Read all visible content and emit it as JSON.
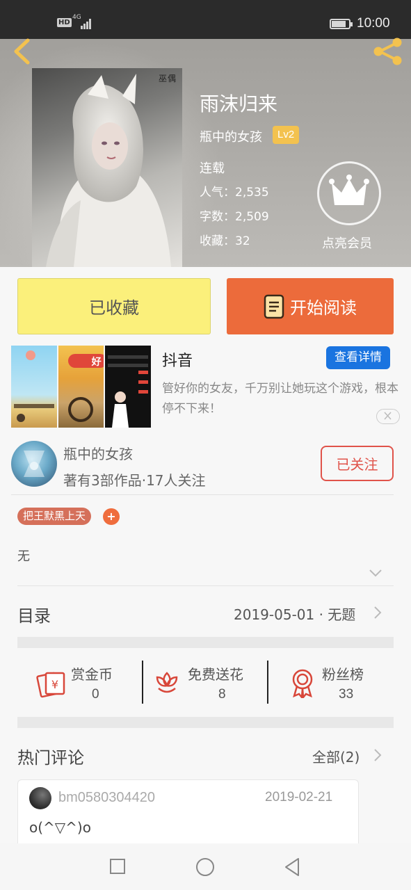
{
  "status_bar": {
    "hd": "HD",
    "network": "4G",
    "time": "10:00"
  },
  "book": {
    "title": "雨沫归来",
    "author": "瓶中的女孩",
    "level": "Lv2",
    "status": "连载",
    "popularity": "人气：2,535",
    "word_count": "字数：2,509",
    "favorites": "收藏：32",
    "vip_label": "点亮会员",
    "cover_watermark": "巫偶"
  },
  "actions": {
    "collected_label": "已收藏",
    "read_label": "开始阅读"
  },
  "ad": {
    "title": "抖音",
    "detail_button": "查看详情",
    "description": "管好你的女友，千万别让她玩这个游戏，根本停不下来！",
    "thumb_text": "好"
  },
  "author_card": {
    "name": "瓶中的女孩",
    "meta": "著有3部作品·17人关注",
    "follow_label": "已关注"
  },
  "tags": {
    "items": [
      "把王默黑上天"
    ],
    "add": "+"
  },
  "synopsis": "无",
  "toc": {
    "label": "目录",
    "latest": "2019-05-01 · 无题"
  },
  "stats_row": [
    {
      "label": "赏金币",
      "count": "0",
      "icon": "coin-envelope-icon"
    },
    {
      "label": "免费送花",
      "count": "8",
      "icon": "flower-icon"
    },
    {
      "label": "粉丝榜",
      "count": "33",
      "icon": "medal-icon"
    }
  ],
  "comments": {
    "title": "热门评论",
    "all_label": "全部(2)",
    "items": [
      {
        "user": "bm0580304420",
        "date": "2019-02-21",
        "text": "o(^▽^)o"
      }
    ]
  },
  "colors": {
    "accent_orange": "#ec6b3b",
    "collected_yellow": "#fbf07b",
    "follow_red": "#e0534a",
    "ad_blue": "#1a74e0",
    "level_gold": "#f3c24f",
    "icon_red": "#d8473a"
  }
}
